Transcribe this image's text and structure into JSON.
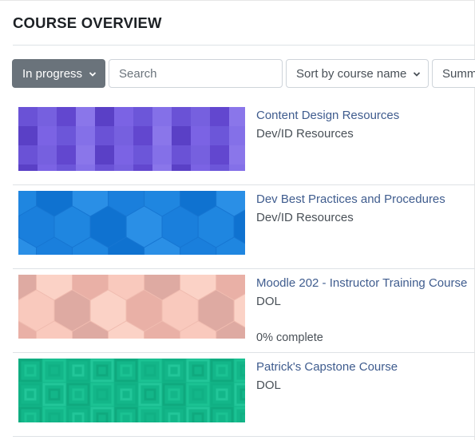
{
  "header": {
    "title": "COURSE OVERVIEW"
  },
  "filters": {
    "grouping_label": "In progress",
    "search_placeholder": "Search",
    "sort_label": "Sort by course name",
    "view_label": "Summary"
  },
  "courses": [
    {
      "name": "Content Design Resources",
      "category": "Dev/ID Resources",
      "progress": "",
      "thumb_color": "#7a5fe0"
    },
    {
      "name": "Dev Best Practices and Procedures",
      "category": "Dev/ID Resources",
      "progress": "",
      "thumb_color": "#1f86e0"
    },
    {
      "name": "Moodle 202 - Instructor Training Course",
      "category": "DOL",
      "progress": "0% complete",
      "thumb_color": "#f8c4b8"
    },
    {
      "name": "Patrick's Capstone Course",
      "category": "DOL",
      "progress": "",
      "thumb_color": "#14b88a"
    }
  ]
}
